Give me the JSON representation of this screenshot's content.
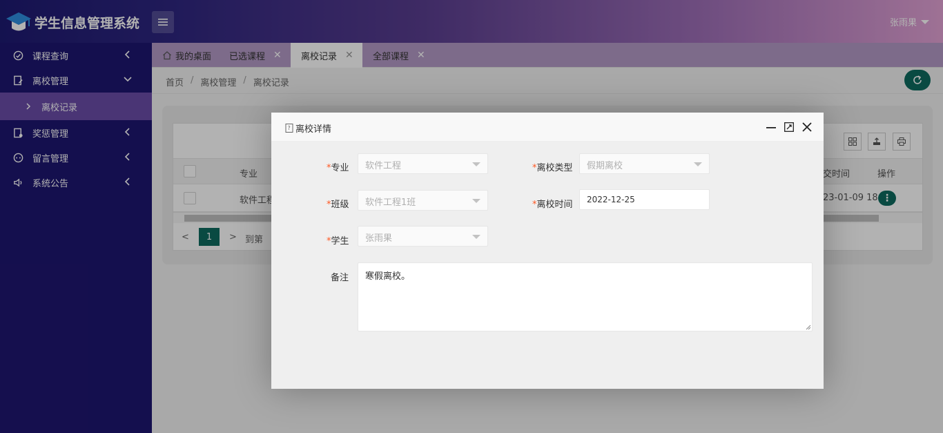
{
  "app": {
    "title": "学生信息管理系统",
    "user_name": "张雨果"
  },
  "sidebar": {
    "items": [
      {
        "label": "课程查询",
        "icon": "compass-icon"
      },
      {
        "label": "离校管理",
        "icon": "document-edit-icon",
        "expanded": true
      },
      {
        "label": "离校记录",
        "sub": true,
        "active": true
      },
      {
        "label": "奖惩管理",
        "icon": "document-badge-icon"
      },
      {
        "label": "留言管理",
        "icon": "message-icon"
      },
      {
        "label": "系统公告",
        "icon": "speaker-icon"
      }
    ]
  },
  "tabs": [
    {
      "label": "我的桌面",
      "icon": "home-icon"
    },
    {
      "label": "已选课程"
    },
    {
      "label": "离校记录",
      "active": true
    },
    {
      "label": "全部课程"
    }
  ],
  "breadcrumb": [
    "首页",
    "离校管理",
    "离校记录"
  ],
  "table": {
    "headers": {
      "major": "专业",
      "time": "交时间",
      "ops": "操作"
    },
    "row": {
      "major": "软件工程",
      "time": "23-01-09 18"
    },
    "pager": {
      "current": "1",
      "goto_label": "到第"
    }
  },
  "modal": {
    "title": "离校详情",
    "fields": {
      "major": {
        "label": "专业",
        "value": "软件工程"
      },
      "leave_type": {
        "label": "离校类型",
        "value": "假期离校"
      },
      "class": {
        "label": "班级",
        "value": "软件工程1班"
      },
      "leave_time": {
        "label": "离校时间",
        "value": "2022-12-25"
      },
      "student": {
        "label": "学生",
        "value": "张雨果"
      },
      "remark": {
        "label": "备注",
        "value": "寒假离校。"
      }
    },
    "required_mark": "*"
  },
  "colors": {
    "primary": "#0d6b5f",
    "sidebar": "#1e1670",
    "sidebar_active": "#6a4ca8"
  }
}
